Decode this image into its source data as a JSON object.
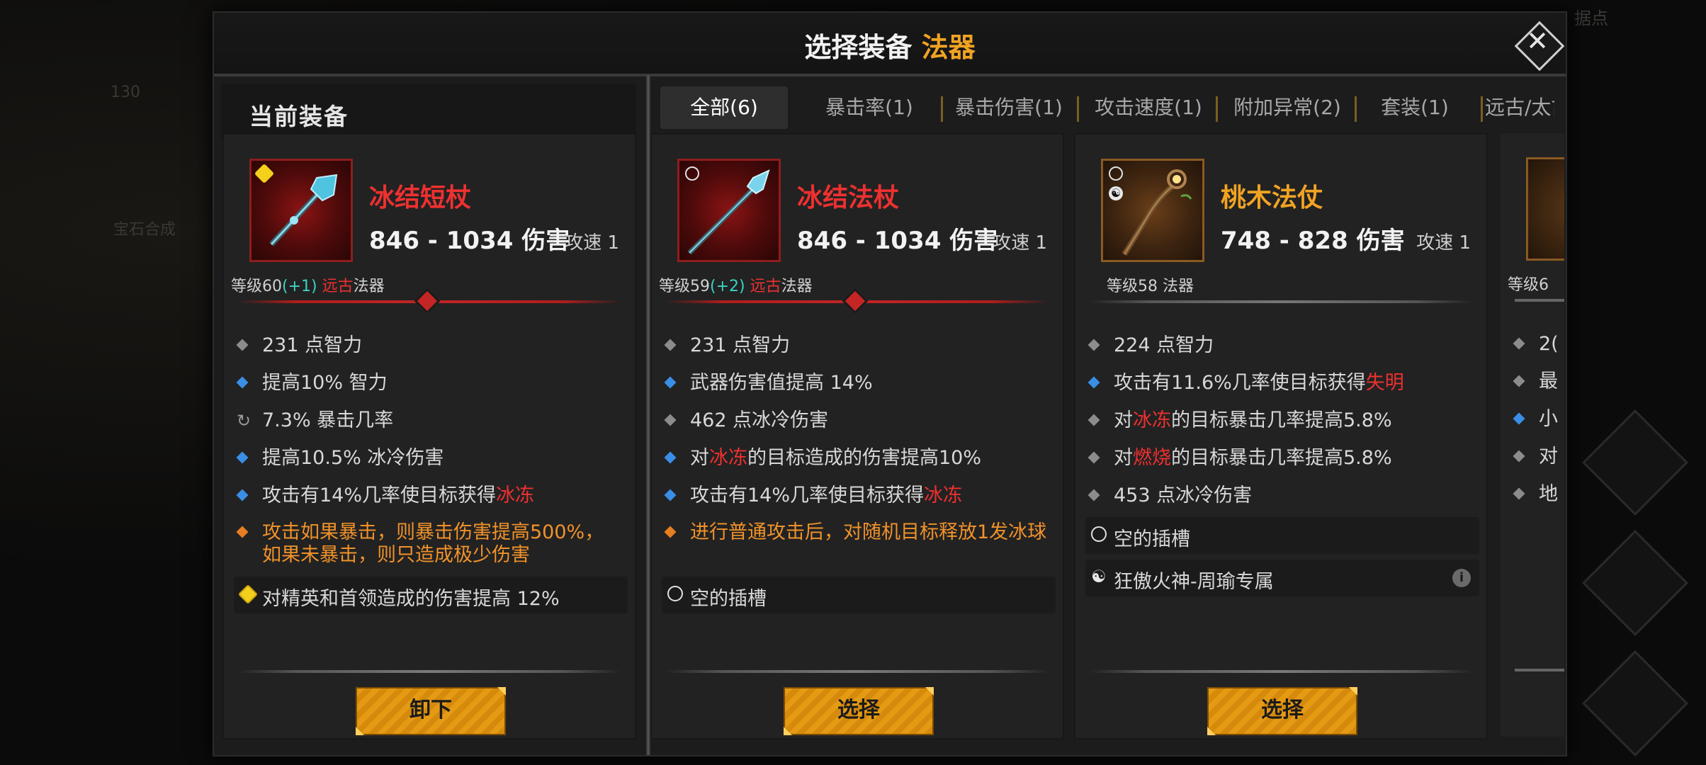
{
  "title": {
    "main": "选择装备",
    "highlight": "法器"
  },
  "left_header": "当前装备",
  "tabs": [
    "全部(6)",
    "暴击率(1)",
    "暴击伤害(1)",
    "攻击速度(1)",
    "附加异常(2)",
    "套装(1)",
    "远古/太古"
  ],
  "background": {
    "top_right": "据点",
    "left_1": "宝石合成",
    "left_2": "130"
  },
  "cards": [
    {
      "name": "冰结短杖",
      "damage": "846 - 1034 伤害",
      "speed": "攻速 1",
      "level_prefix": "等级60",
      "level_plus": "(+1)",
      "ancient": "远古",
      "type": "法器",
      "stats": [
        {
          "bullet": "grey",
          "text": "231 点智力"
        },
        {
          "bullet": "blue",
          "text": "提高10% 智力"
        },
        {
          "bullet": "reroll",
          "text": "7.3% 暴击几率"
        },
        {
          "bullet": "blue",
          "text": "提高10.5% 冰冷伤害"
        },
        {
          "bullet": "blue",
          "pre": "攻击有14%几率使目标获得",
          "hl": "冰冻"
        },
        {
          "bullet": "orange",
          "text": "攻击如果暴击，则暴击伤害提高500%，如果未暴击，则只造成极少伤害"
        }
      ],
      "socket": "对精英和首领造成的伤害提高 12%",
      "button": "卸下"
    },
    {
      "name": "冰结法杖",
      "damage": "846 - 1034 伤害",
      "speed": "攻速 1",
      "level_prefix": "等级59",
      "level_plus": "(+2)",
      "ancient": "远古",
      "type": "法器",
      "stats": [
        {
          "bullet": "grey",
          "text": "231 点智力"
        },
        {
          "bullet": "blue",
          "text": "武器伤害值提高 14%"
        },
        {
          "bullet": "grey",
          "text": "462 点冰冷伤害"
        },
        {
          "bullet": "blue",
          "pre": "对",
          "hl": "冰冻",
          "post": "的目标造成的伤害提高10%"
        },
        {
          "bullet": "blue",
          "pre": "攻击有14%几率使目标获得",
          "hl": "冰冻"
        },
        {
          "bullet": "orange",
          "text": "进行普通攻击后，对随机目标释放1发冰球"
        }
      ],
      "socket": "空的插槽",
      "button": "选择"
    },
    {
      "name": "桃木法仗",
      "damage": "748 - 828 伤害",
      "speed": "攻速 1",
      "level_text": "等级58 法器",
      "stats": [
        {
          "bullet": "grey",
          "text": "224 点智力"
        },
        {
          "bullet": "blue",
          "pre": "攻击有11.6%几率使目标获得",
          "hl": "失明"
        },
        {
          "bullet": "grey",
          "pre": "对",
          "hl": "冰冻",
          "post": "的目标暴击几率提高5.8%"
        },
        {
          "bullet": "grey",
          "pre": "对",
          "hl": "燃烧",
          "post": "的目标暴击几率提高5.8%"
        },
        {
          "bullet": "grey",
          "text": "453 点冰冷伤害"
        }
      ],
      "socket": "空的插槽",
      "set": "狂傲火神-周瑜专属",
      "button": "选择"
    }
  ],
  "card4_partial": {
    "level": "等级6",
    "lines": [
      "2(",
      "最",
      "小",
      "对",
      "地"
    ]
  },
  "colors": {
    "accent": "#f0a323",
    "red": "#ee3030",
    "teal": "#3ad3c2",
    "blue": "#3a8ee6"
  }
}
